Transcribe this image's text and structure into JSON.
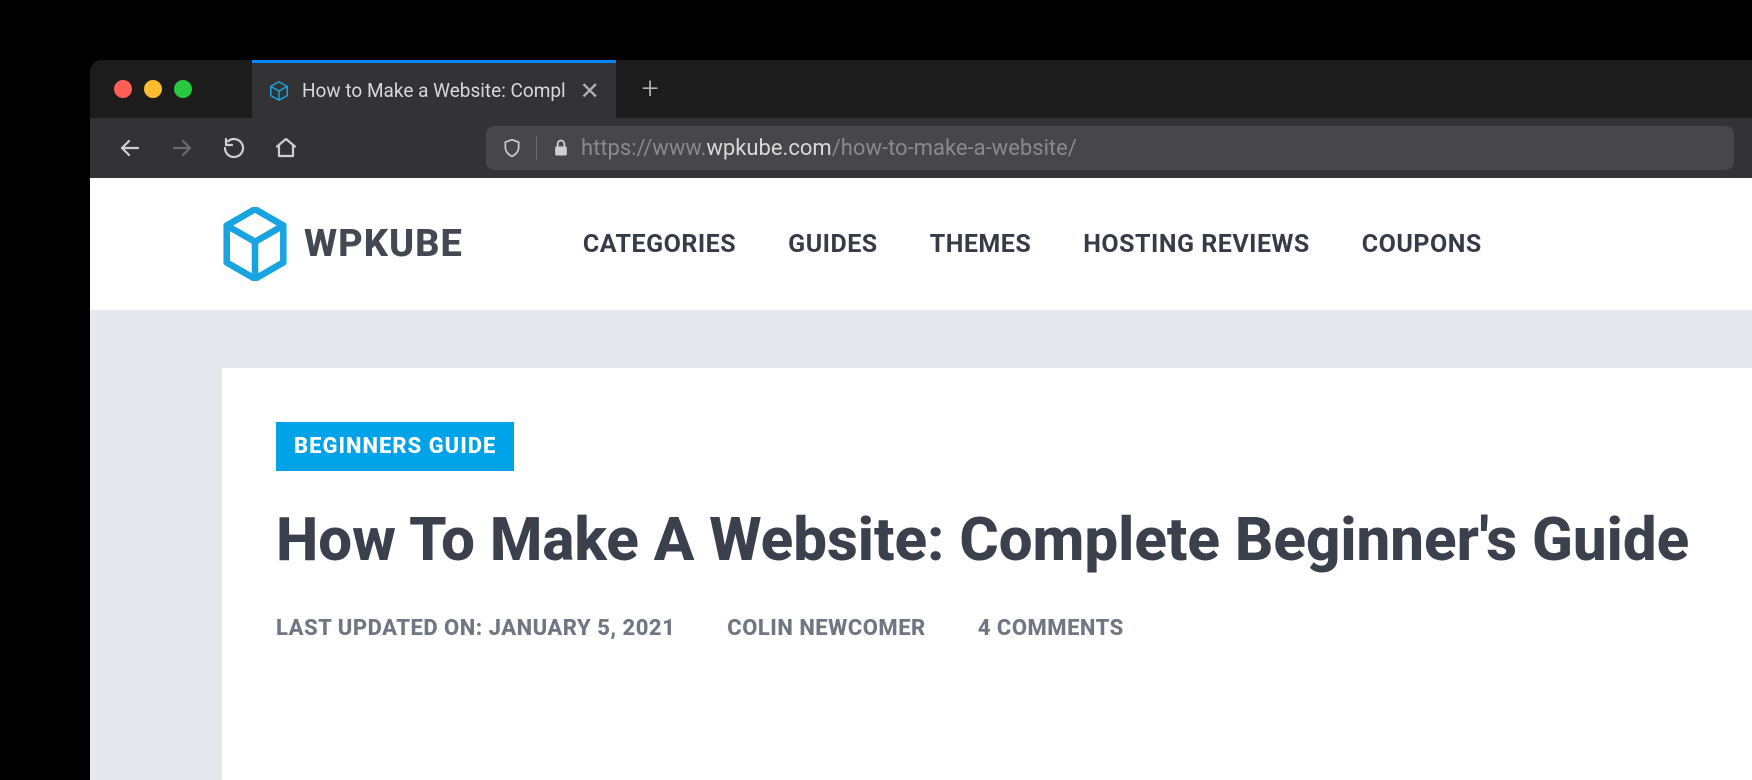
{
  "browser": {
    "tab": {
      "title": "How to Make a Website: Compl"
    },
    "url": {
      "protocol": "https://",
      "sub": "www.",
      "domain": "wpkube.com",
      "path": "/how-to-make-a-website/"
    }
  },
  "site": {
    "logo_text": "WPKUBE",
    "nav": [
      "CATEGORIES",
      "GUIDES",
      "THEMES",
      "HOSTING REVIEWS",
      "COUPONS"
    ]
  },
  "article": {
    "category": "BEGINNERS GUIDE",
    "title": "How To Make A Website: Complete Beginner's Guide",
    "updated_label": "LAST UPDATED ON:",
    "updated_date": "JANUARY 5, 2021",
    "author": "COLIN NEWCOMER",
    "comments": "4 COMMENTS"
  }
}
